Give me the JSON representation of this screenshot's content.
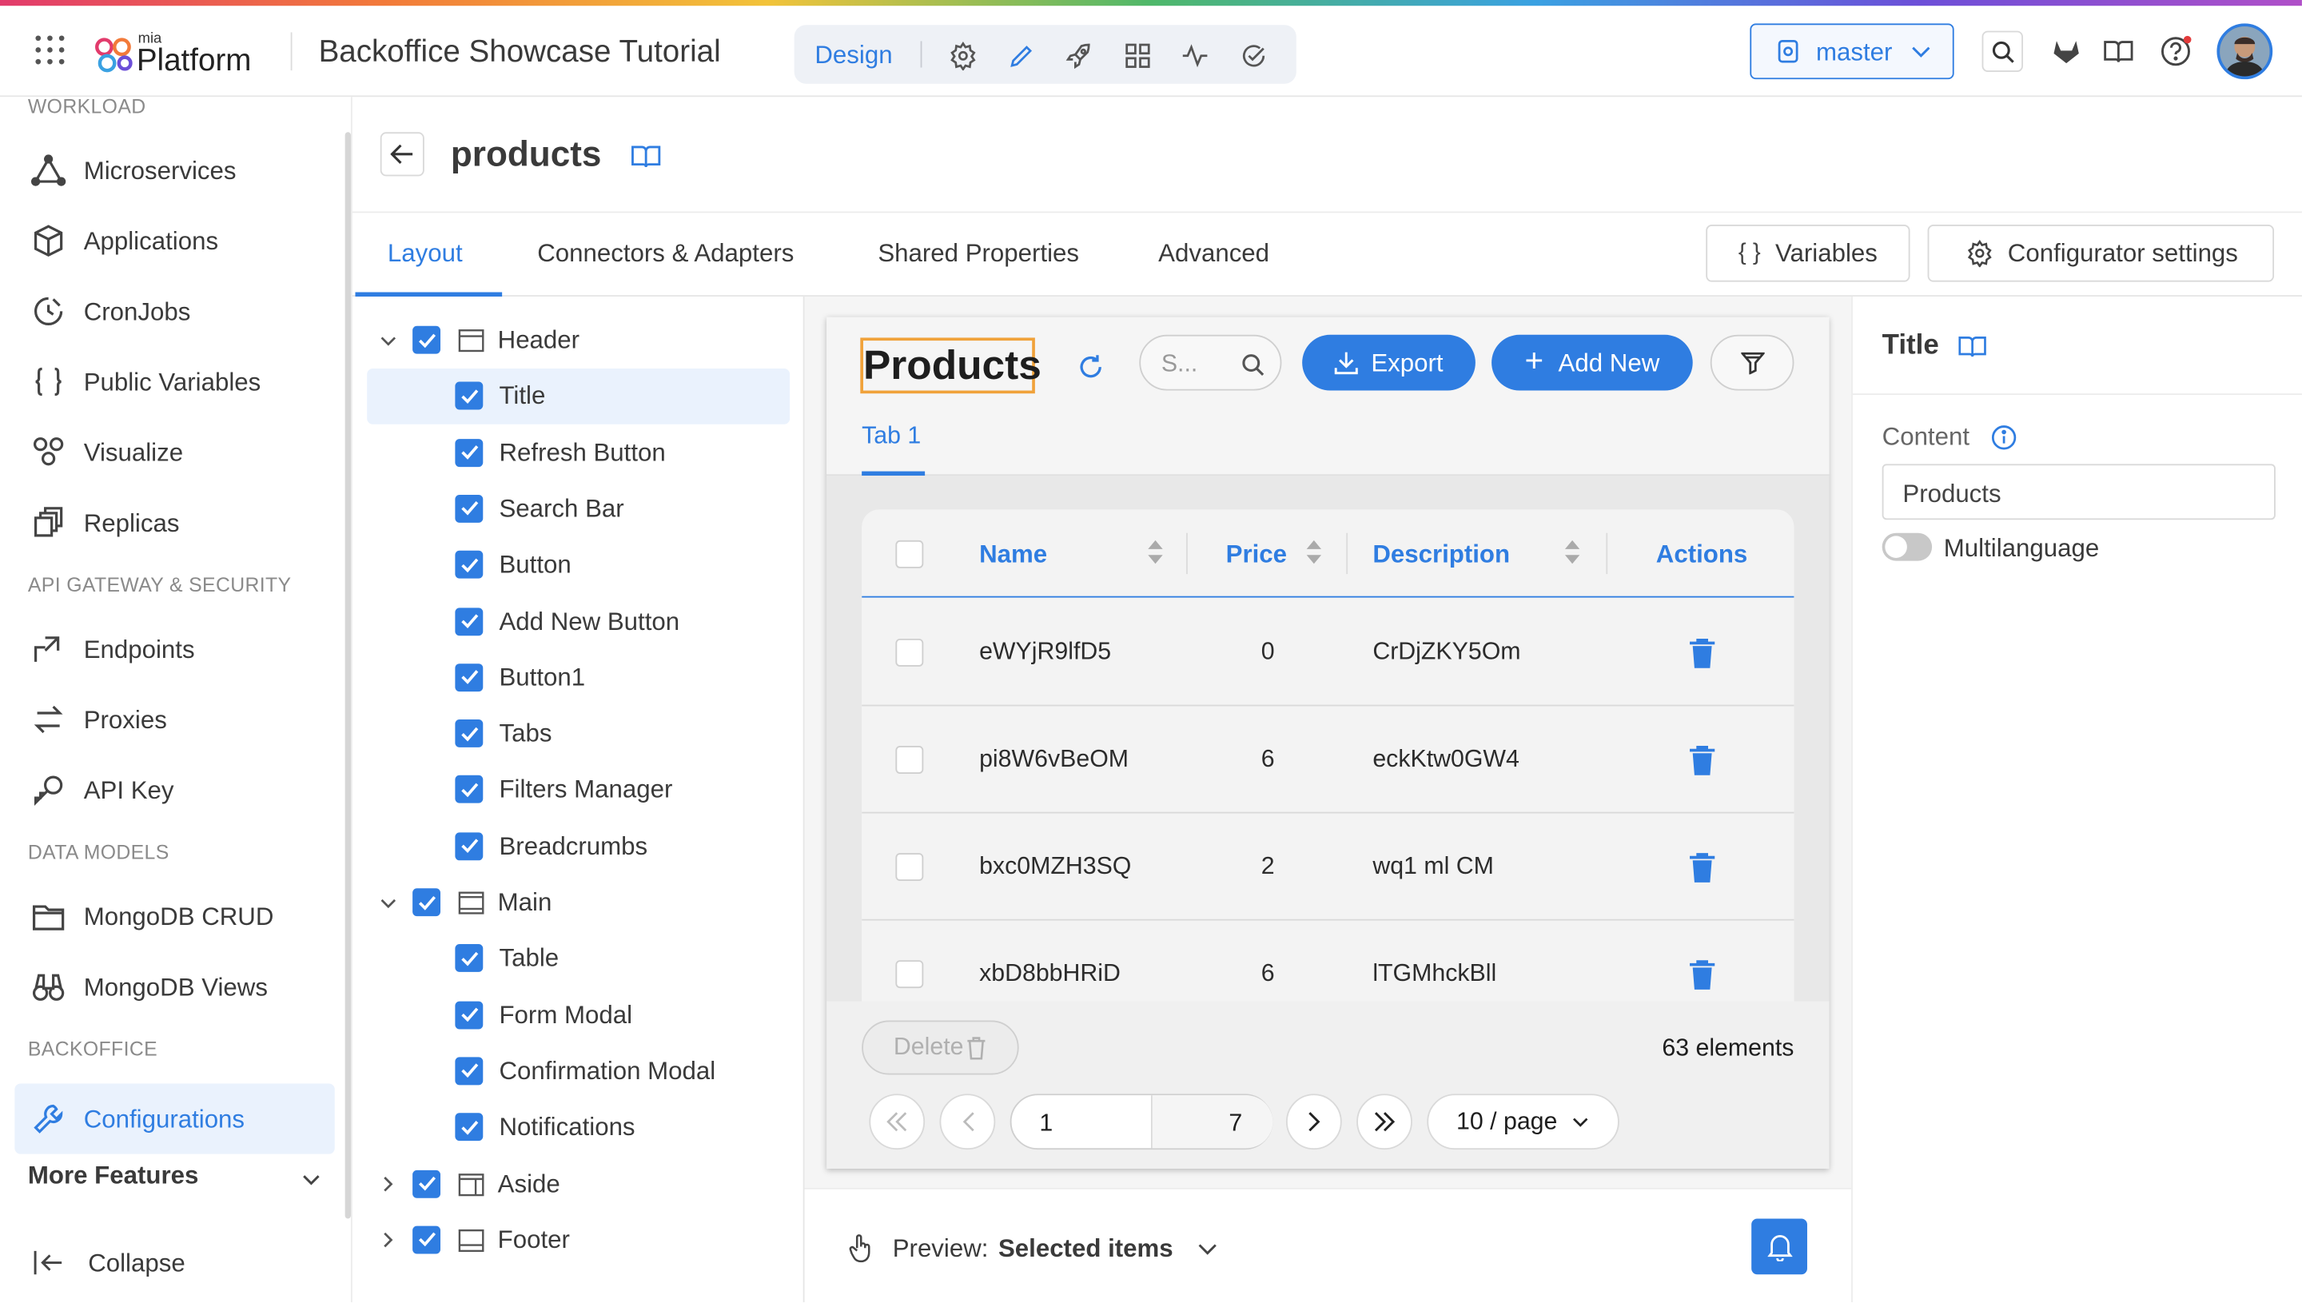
{
  "brand": {
    "small": "mia",
    "name": "Platform"
  },
  "project_title": "Backoffice Showcase Tutorial",
  "topnav": {
    "active": "Design",
    "icons": [
      "settings-icon",
      "pencil-icon",
      "rocket-icon",
      "dashboard-icon",
      "activity-icon",
      "check-circle-icon"
    ]
  },
  "branch": "master",
  "colors": {
    "accent": "#2f7de1",
    "accent_light": "#eaf2fd",
    "highlight": "#f0a23a"
  },
  "sidebar": {
    "sections": [
      {
        "title": "WORKLOAD",
        "items": [
          {
            "label": "Microservices",
            "icon": "microservices-icon"
          },
          {
            "label": "Applications",
            "icon": "cube-icon"
          },
          {
            "label": "CronJobs",
            "icon": "clock-icon"
          },
          {
            "label": "Public Variables",
            "icon": "braces-icon"
          },
          {
            "label": "Visualize",
            "icon": "nodes-icon"
          },
          {
            "label": "Replicas",
            "icon": "replicas-icon"
          }
        ]
      },
      {
        "title": "API GATEWAY & SECURITY",
        "items": [
          {
            "label": "Endpoints",
            "icon": "endpoint-icon"
          },
          {
            "label": "Proxies",
            "icon": "swap-icon"
          },
          {
            "label": "API Key",
            "icon": "key-icon"
          }
        ]
      },
      {
        "title": "DATA MODELS",
        "items": [
          {
            "label": "MongoDB CRUD",
            "icon": "folder-icon"
          },
          {
            "label": "MongoDB Views",
            "icon": "binoculars-icon"
          }
        ]
      },
      {
        "title": "BACKOFFICE",
        "items": [
          {
            "label": "Configurations",
            "icon": "wrench-icon",
            "selected": true
          }
        ]
      }
    ],
    "more_features": "More Features",
    "collapse": "Collapse"
  },
  "page": {
    "title": "products"
  },
  "tabs": [
    "Layout",
    "Connectors & Adapters",
    "Shared Properties",
    "Advanced"
  ],
  "active_tab": "Layout",
  "toolbar": {
    "variables": "Variables",
    "configurator": "Configurator settings"
  },
  "tree": [
    {
      "label": "Header",
      "level": 0,
      "expanded": true,
      "icon": "header-layout-icon"
    },
    {
      "label": "Title",
      "level": 1,
      "selected": true
    },
    {
      "label": "Refresh Button",
      "level": 1
    },
    {
      "label": "Search Bar",
      "level": 1
    },
    {
      "label": "Button",
      "level": 1
    },
    {
      "label": "Add New Button",
      "level": 1
    },
    {
      "label": "Button1",
      "level": 1
    },
    {
      "label": "Tabs",
      "level": 1
    },
    {
      "label": "Filters Manager",
      "level": 1
    },
    {
      "label": "Breadcrumbs",
      "level": 1
    },
    {
      "label": "Main",
      "level": 0,
      "expanded": true,
      "icon": "main-layout-icon"
    },
    {
      "label": "Table",
      "level": 1
    },
    {
      "label": "Form Modal",
      "level": 1
    },
    {
      "label": "Confirmation Modal",
      "level": 1
    },
    {
      "label": "Notifications",
      "level": 1
    },
    {
      "label": "Aside",
      "level": 0,
      "expanded": false,
      "icon": "aside-layout-icon"
    },
    {
      "label": "Footer",
      "level": 0,
      "expanded": false,
      "icon": "footer-layout-icon"
    }
  ],
  "preview": {
    "title": "Products",
    "search_placeholder": "S...",
    "export": "Export",
    "add_new": "Add New",
    "tab": "Tab 1",
    "columns": [
      "Name",
      "Price",
      "Description",
      "Actions"
    ],
    "rows": [
      {
        "name": "eWYjR9lfD5",
        "price": "0",
        "description": "CrDjZKY5Om"
      },
      {
        "name": "pi8W6vBeOM",
        "price": "6",
        "description": "eckKtw0GW4"
      },
      {
        "name": "bxc0MZH3SQ",
        "price": "2",
        "description": "wq1 ml CM"
      },
      {
        "name": "xbD8bbHRiD",
        "price": "6",
        "description": "lTGMhckBll"
      }
    ],
    "delete": "Delete",
    "count": "63 elements",
    "current_page": "1",
    "total_pages": "7",
    "page_size": "10 / page"
  },
  "preview_bar": {
    "label": "Preview:",
    "value": "Selected items"
  },
  "inspector": {
    "title": "Title",
    "content_label": "Content",
    "content_value": "Products",
    "multilanguage": "Multilanguage",
    "multilanguage_on": false
  }
}
